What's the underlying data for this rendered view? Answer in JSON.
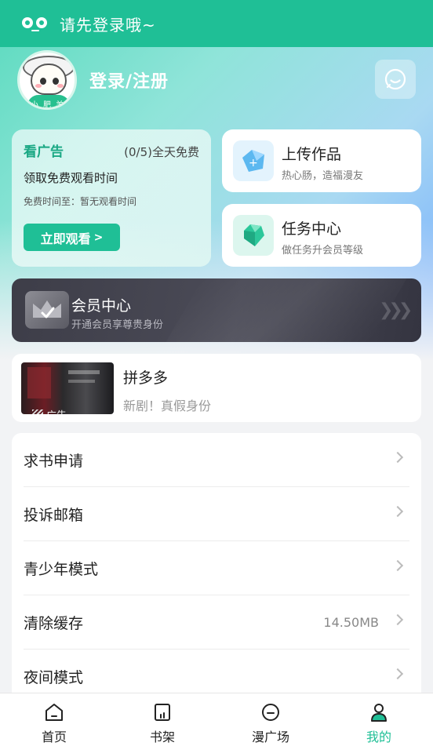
{
  "topbar": {
    "title": "请先登录哦~"
  },
  "profile": {
    "login_label": "登录/注册",
    "avatar_text": "小肥羊"
  },
  "ad_card": {
    "title": "看广告",
    "count": "(0/5)全天免费",
    "subtitle": "领取免费观看时间",
    "free_time": "免费时间至：暂无观看时间",
    "button": "立即观看"
  },
  "upload": {
    "title": "上传作品",
    "subtitle": "热心肠，造福漫友"
  },
  "tasks": {
    "title": "任务中心",
    "subtitle": "做任务升会员等级"
  },
  "vip": {
    "title": "会员中心",
    "subtitle": "开通会员享尊贵身份"
  },
  "promo": {
    "title": "拼多多",
    "subtitle": "新剧！真假身份",
    "ad_tag": "广告"
  },
  "menu": {
    "items": [
      {
        "label": "求书申请",
        "value": ""
      },
      {
        "label": "投诉邮箱",
        "value": ""
      },
      {
        "label": "青少年模式",
        "value": ""
      },
      {
        "label": "清除缓存",
        "value": "14.50MB"
      },
      {
        "label": "夜间模式",
        "value": ""
      }
    ]
  },
  "tabbar": {
    "items": [
      {
        "label": "首页",
        "icon": "home-icon"
      },
      {
        "label": "书架",
        "icon": "bookshelf-icon"
      },
      {
        "label": "漫广场",
        "icon": "plaza-icon"
      },
      {
        "label": "我的",
        "icon": "profile-icon"
      }
    ],
    "active_index": 3
  },
  "colors": {
    "accent": "#1fbf96",
    "vip_bg": "#3d3d48"
  }
}
